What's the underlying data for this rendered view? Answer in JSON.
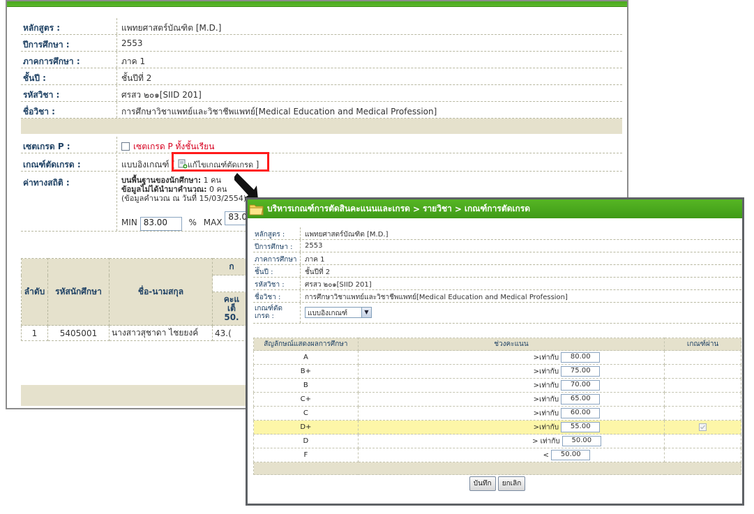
{
  "main": {
    "fields": [
      {
        "label": "หลักสูตร :",
        "value": "แพทยศาสตร์บัณฑิต [M.D.]"
      },
      {
        "label": "ปีการศึกษา :",
        "value": "2553"
      },
      {
        "label": "ภาคการศึกษา :",
        "value": "ภาค 1"
      },
      {
        "label": "ชั้นปี :",
        "value": "ชั้นปีที่ 2"
      },
      {
        "label": "รหัสวิชา :",
        "value": "ศรสว ๒๐๑[SIID 201]"
      },
      {
        "label": "ชื่อวิชา :",
        "value": "การศึกษาวิชาแพทย์และวิชาชีพแพทย์[Medical Education and Medical Profession]"
      }
    ],
    "set_grade_p": {
      "label": "เซตเกรด P :",
      "checkbox_label": "เซตเกรด P ทั้งชั้นเรียน"
    },
    "criteria": {
      "label": "เกณฑ์ตัดเกรด :",
      "value": "แบบอิงเกณฑ์",
      "open_bracket": "[",
      "edit_label": "แก้ไขเกณฑ์ตัดเกรด",
      "close_bracket": "]"
    },
    "stats": {
      "label": "ค่าทางสถิติ :",
      "line1_label": "บนพื้นฐานของนักศึกษา:",
      "line1_value": " 1 คน",
      "line2_label": "ข้อมูลไม่ได้นำมาคำนวณ:",
      "line2_value": " 0 คน",
      "line3": "(ข้อมูลคำนวณ ณ วันที่ 15/03/2554)",
      "min_label": "MIN",
      "min_value": "83.00",
      "pct": "%",
      "max_label": "MAX",
      "max_value": "83.00"
    },
    "table": {
      "h_no": "ลำดับ",
      "h_id": "รหัสนักศึกษา",
      "h_name": "ชื่อ-นามสกุล",
      "h_group": "ก",
      "h_score1": "คะแ",
      "h_score2": "เต็",
      "h_score3": "50.",
      "rows": [
        {
          "no": "1",
          "id": "5405001",
          "name": "นางสาวสุชาดา ไชยยงค์",
          "score": "43.("
        }
      ]
    }
  },
  "popup": {
    "breadcrumb": [
      "บริหารเกณฑ์การตัดสินคะแนนและเกรด",
      ">",
      "รายวิชา",
      ">",
      "เกณฑ์การตัดเกรด"
    ],
    "fields": [
      {
        "label": "หลักสูตร :",
        "value": "แพทยศาสตร์บัณฑิต [M.D.]"
      },
      {
        "label": "ปีการศึกษา :",
        "value": "2553"
      },
      {
        "label": "ภาคการศึกษา :",
        "value": "ภาค 1"
      },
      {
        "label": "ชั้นปี :",
        "value": "ชั้นปีที่ 2"
      },
      {
        "label": "รหัสวิชา :",
        "value": "ศรสว ๒๐๑[SIID 201]"
      },
      {
        "label": "ชื่อวิชา :",
        "value": "การศึกษาวิชาแพทย์และวิชาชีพแพทย์[Medical Education and Medical Profession]"
      }
    ],
    "criteria_label_1": "เกณฑ์ตัด",
    "criteria_label_2": "เกรด :",
    "criteria_value": "แบบอิงเกณฑ์",
    "headers": {
      "symbol": "สัญลักษณ์แสดงผลการศึกษา",
      "range": "ช่วงคะแนน",
      "pass": "เกณฑ์ผ่าน"
    },
    "grades": [
      {
        "grade": "A",
        "op": ">เท่ากับ",
        "value": "80.00",
        "pass": false,
        "highlight": false
      },
      {
        "grade": "B+",
        "op": ">เท่ากับ",
        "value": "75.00",
        "pass": false,
        "highlight": false
      },
      {
        "grade": "B",
        "op": ">เท่ากับ",
        "value": "70.00",
        "pass": false,
        "highlight": false
      },
      {
        "grade": "C+",
        "op": ">เท่ากับ",
        "value": "65.00",
        "pass": false,
        "highlight": false
      },
      {
        "grade": "C",
        "op": ">เท่ากับ",
        "value": "60.00",
        "pass": false,
        "highlight": false
      },
      {
        "grade": "D+",
        "op": ">เท่ากับ",
        "value": "55.00",
        "pass": true,
        "highlight": true
      },
      {
        "grade": "D",
        "op": "> เท่ากับ",
        "value": "50.00",
        "pass": false,
        "highlight": false
      },
      {
        "grade": "F",
        "op": "<",
        "value": "50.00",
        "pass": false,
        "highlight": false
      }
    ],
    "save_label": "บันทึก",
    "cancel_label": "ยกเลิก"
  }
}
